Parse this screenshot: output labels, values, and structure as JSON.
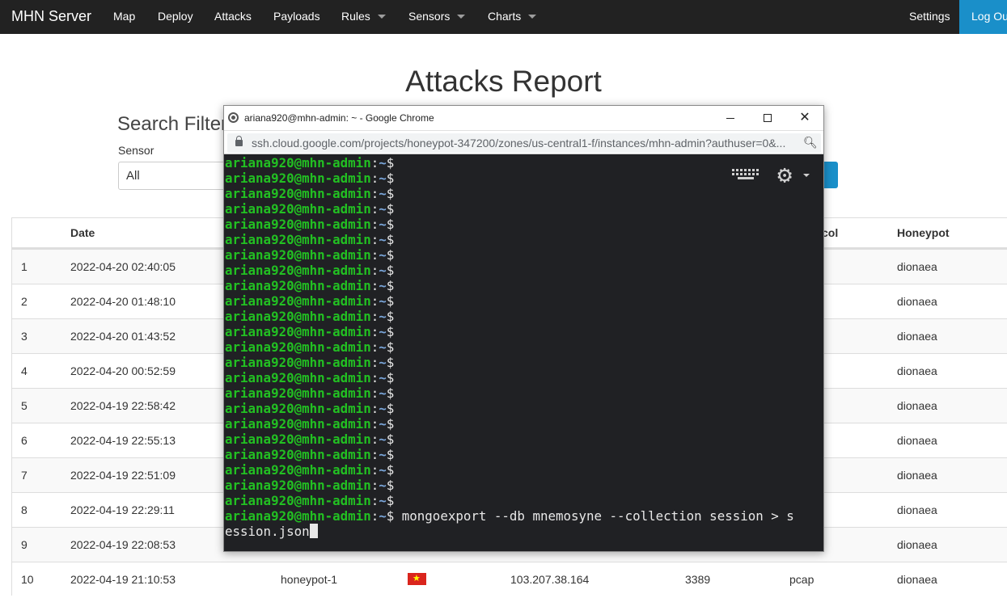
{
  "navbar": {
    "brand": "MHN Server",
    "items": [
      {
        "label": "Map"
      },
      {
        "label": "Deploy"
      },
      {
        "label": "Attacks"
      },
      {
        "label": "Payloads"
      },
      {
        "label": "Rules",
        "dropdown": true
      },
      {
        "label": "Sensors",
        "dropdown": true
      },
      {
        "label": "Charts",
        "dropdown": true
      }
    ],
    "settings": "Settings",
    "logout": "Log Out",
    "logout_color": "#1a8fc9"
  },
  "page": {
    "title": "Attacks Report",
    "filters_title": "Search Filters",
    "sensor_label": "Sensor",
    "sensor_value": "All"
  },
  "table": {
    "headers": {
      "date": "Date",
      "protocol": "col",
      "honeypot": "Honeypot"
    },
    "rows": [
      {
        "num": "1",
        "date": "2022-04-20 02:40:05",
        "honeypot": "dionaea"
      },
      {
        "num": "2",
        "date": "2022-04-20 01:48:10",
        "honeypot": "dionaea"
      },
      {
        "num": "3",
        "date": "2022-04-20 01:43:52",
        "honeypot": "dionaea"
      },
      {
        "num": "4",
        "date": "2022-04-20 00:52:59",
        "honeypot": "dionaea"
      },
      {
        "num": "5",
        "date": "2022-04-19 22:58:42",
        "honeypot": "dionaea"
      },
      {
        "num": "6",
        "date": "2022-04-19 22:55:13",
        "honeypot": "dionaea"
      },
      {
        "num": "7",
        "date": "2022-04-19 22:51:09",
        "honeypot": "dionaea"
      },
      {
        "num": "8",
        "date": "2022-04-19 22:29:11",
        "honeypot": "dionaea"
      },
      {
        "num": "9",
        "date": "2022-04-19 22:08:53",
        "honeypot": "dionaea"
      },
      {
        "num": "10",
        "date": "2022-04-19 21:10:53",
        "sensor": "honeypot-1",
        "country_flag": "vietnam-flag-icon",
        "ip": "103.207.38.164",
        "port": "3389",
        "protocol": "pcap",
        "honeypot": "dionaea"
      }
    ]
  },
  "ssh_window": {
    "title": "ariana920@mhn-admin: ~ - Google Chrome",
    "minimize": "minimize-icon",
    "maximize": "maximize-icon",
    "close": "✕",
    "url": "ssh.cloud.google.com/projects/honeypot-347200/zones/us-central1-f/instances/mhn-admin?authuser=0&...",
    "prompt_user": "ariana920@mhn-admin",
    "prompt_sep": ":",
    "prompt_path": "~",
    "prompt_end": "$",
    "empty_prompt_count": 23,
    "command_line": " mongoexport --db mnemosyne --collection session > s",
    "command_wrap": "ession.json",
    "colors": {
      "user": "#22c022",
      "path": "#7aa6da",
      "background": "#202124"
    }
  }
}
